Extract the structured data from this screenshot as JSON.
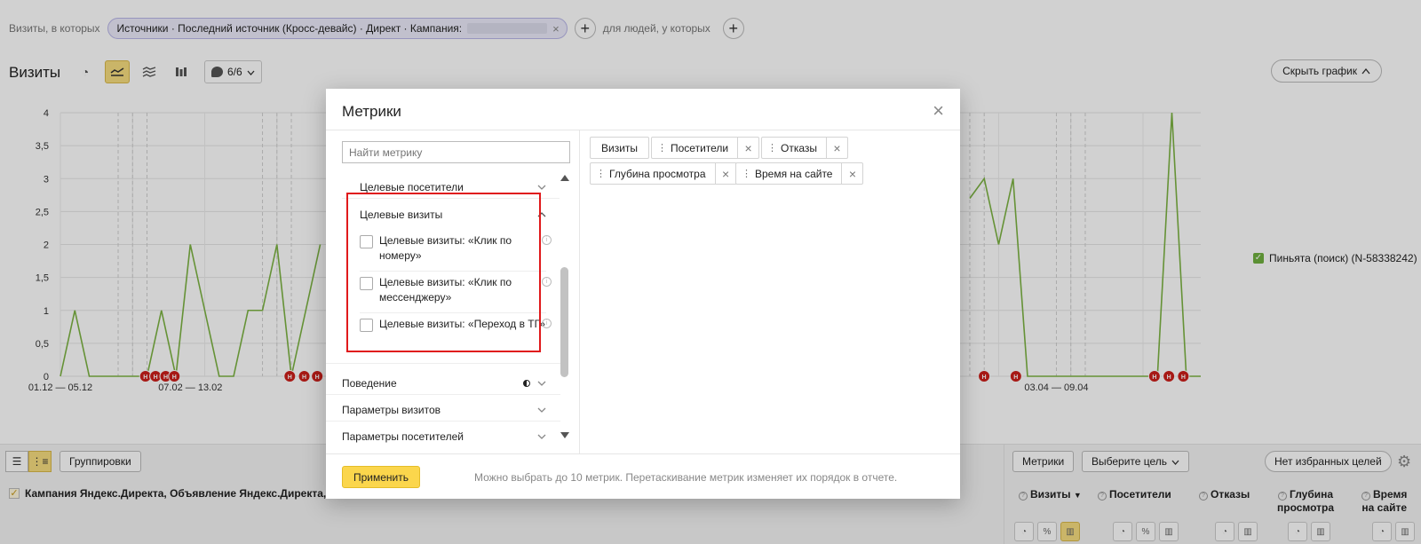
{
  "segment": {
    "prefix": "Визиты, в которых",
    "chip_text": "Источники · Последний источник (Кросс-девайс) · Директ · Кампания:",
    "chip_close": "×",
    "people_text": "для людей, у которых",
    "plus": "+"
  },
  "chart_header": {
    "title": "Визиты",
    "notes_count": "6/6",
    "hide_chart": "Скрыть график"
  },
  "chart_data": {
    "type": "line",
    "y_ticks": [
      "0",
      "0,5",
      "1",
      "1,5",
      "2",
      "2,5",
      "3",
      "3,5",
      "4"
    ],
    "x_labels": [
      {
        "label": "01.12 — 05.12",
        "index": 0
      },
      {
        "label": "07.02 — 13.02",
        "index": 9
      },
      {
        "label": "03.04 — 09.04",
        "index": 69
      }
    ],
    "ylim": [
      0,
      4
    ],
    "series": [
      {
        "name": "Пиньята (поиск) (N-58338242)",
        "color": "#7cb342",
        "values_left": [
          0,
          1,
          0,
          0,
          0,
          0,
          0,
          1,
          0,
          2,
          1,
          0,
          0,
          1,
          1,
          2,
          0,
          1,
          2
        ],
        "values_right": [
          2.7,
          3,
          2,
          3,
          0,
          0,
          0,
          0,
          0,
          0,
          0,
          0,
          0,
          0,
          4,
          0,
          0
        ]
      }
    ],
    "grid": true,
    "marker_label": "Н"
  },
  "legend": {
    "item": "Пиньята (поиск) (N-58338242)"
  },
  "bottom": {
    "groupings": "Группировки",
    "campaign_row": "Кампания Яндекс.Директа, Объявление Яндекс.Директа, Ус",
    "metrics_btn": "Метрики",
    "goal_btn": "Выберите цель",
    "fav_goals": "Нет избранных целей",
    "columns": [
      {
        "line1": "Визиты",
        "line2": "",
        "sorted": "▼"
      },
      {
        "line1": "Посетители",
        "line2": ""
      },
      {
        "line1": "Отказы",
        "line2": ""
      },
      {
        "line1": "Глубина",
        "line2": "просмотра"
      },
      {
        "line1": "Время",
        "line2": "на сайте"
      }
    ],
    "mini_icons": {
      "pie": "◔",
      "percent": "%",
      "bars": "▥"
    }
  },
  "modal": {
    "title": "Метрики",
    "close": "×",
    "search_placeholder": "Найти метрику",
    "sections": {
      "target_visitors": "Целевые посетители",
      "target_visits": "Целевые визиты",
      "behavior": "Поведение",
      "visit_params": "Параметры визитов",
      "visitor_params": "Параметры посетителей"
    },
    "options": [
      {
        "label": "Целевые визиты: «Клик по номеру»"
      },
      {
        "label": "Целевые визиты: «Клик по мессенджеру»"
      },
      {
        "label": "Целевые визиты: «Переход в ТГ»"
      }
    ],
    "selected": [
      {
        "label": "Визиты",
        "removable": false
      },
      {
        "label": "Посетители",
        "removable": true
      },
      {
        "label": "Отказы",
        "removable": true
      },
      {
        "label": "Глубина просмотра",
        "removable": true
      },
      {
        "label": "Время на сайте",
        "removable": true
      }
    ],
    "apply": "Применить",
    "hint": "Можно выбрать до 10 метрик. Перетаскивание метрик изменяет их порядок в отчете."
  },
  "colors": {
    "accent_yellow": "#fbd64c",
    "line_green": "#7cb342",
    "marker_red": "#cc1f1a",
    "highlight_red": "#e0191b"
  }
}
